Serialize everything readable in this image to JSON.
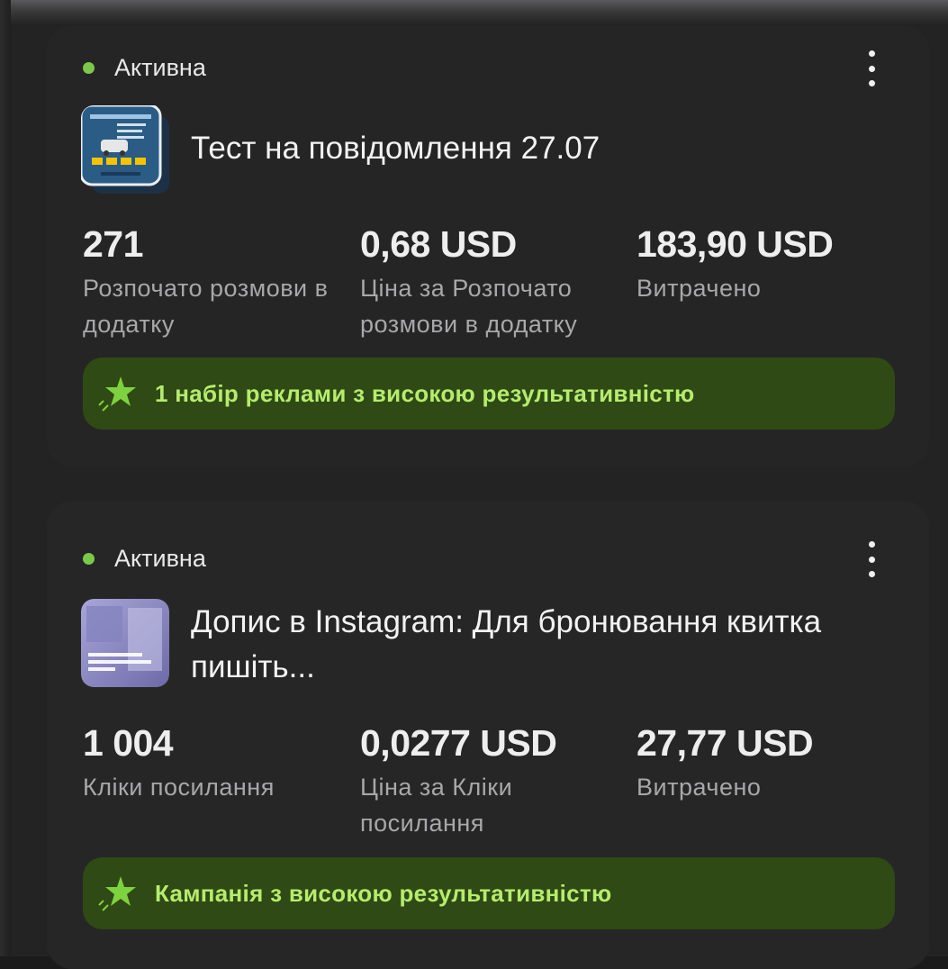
{
  "icons": {
    "more": "more-vertical-icon",
    "star": "sparkle-star-icon",
    "status": "status-dot-icon"
  },
  "colors": {
    "status_active": "#7bc84a",
    "banner_bg": "#2f4a14",
    "banner_text": "#b6ec6e",
    "card_bg": "#262627"
  },
  "campaigns": [
    {
      "status": "Активна",
      "title": "Тест на повідомлення 27.07",
      "metrics": [
        {
          "value": "271",
          "label": "Розпочато розмови в додатку"
        },
        {
          "value": "0,68 USD",
          "label": "Ціна за Розпочато розмови в додатку"
        },
        {
          "value": "183,90 USD",
          "label": "Витрачено"
        }
      ],
      "banner": "1 набір реклами з високою результативністю"
    },
    {
      "status": "Активна",
      "title": "Допис в Instagram: Для бронювання квитка пишіть...",
      "metrics": [
        {
          "value": "1 004",
          "label": "Кліки посилання"
        },
        {
          "value": "0,0277 USD",
          "label": "Ціна за Кліки посилання"
        },
        {
          "value": "27,77 USD",
          "label": "Витрачено"
        }
      ],
      "banner": "Кампанія з високою результативністю"
    }
  ]
}
